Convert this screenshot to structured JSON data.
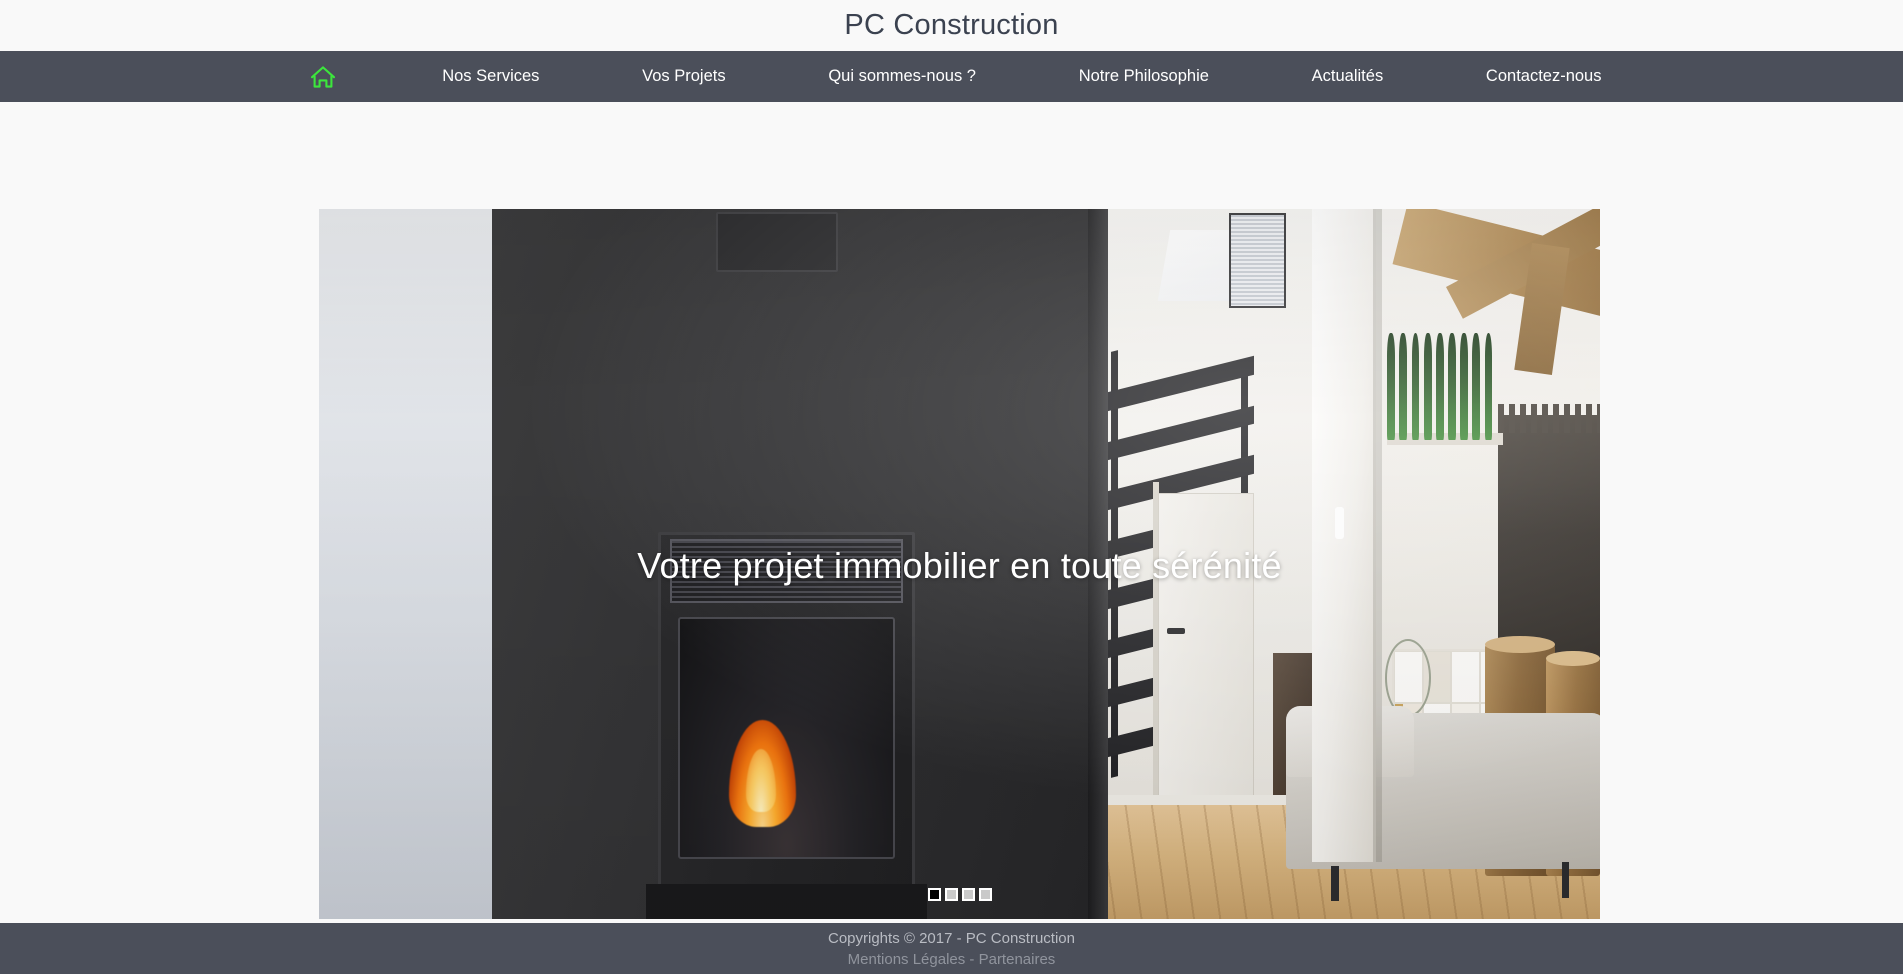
{
  "header": {
    "title": "PC Construction"
  },
  "nav": {
    "home_icon": "home-icon",
    "items": [
      {
        "label": "Nos Services"
      },
      {
        "label": "Vos Projets"
      },
      {
        "label": "Qui sommes-nous ?"
      },
      {
        "label": "Notre Philosophie"
      },
      {
        "label": "Actualités"
      },
      {
        "label": "Contactez-nous"
      }
    ]
  },
  "hero": {
    "caption": "Votre projet immobilier en toute sérénité",
    "slides_count": 4,
    "active_slide": 1,
    "image_description": "Loft intérieur moderne avec poêle à bois, mur gris anthracite, parquet clair, escalier métallique noir, étagère blanche, canapé gris et poutre en bois"
  },
  "footer": {
    "copyright": "Copyrights © 2017 - PC Construction",
    "legal_link": "Mentions Légales",
    "separator": " - ",
    "partners_link": "Partenaires"
  },
  "colors": {
    "page_background": "#f9f9f9",
    "bar_background": "#4b4f5a",
    "title_text": "#3b4250",
    "nav_text": "#ffffff",
    "home_icon_green": "#3ce63c",
    "caption_text": "#ffffff",
    "footer_copy_text": "#b9bcc3",
    "footer_link_text": "#90949d",
    "pager_active": "#000000",
    "pager_inactive": "#c9c9c9"
  }
}
